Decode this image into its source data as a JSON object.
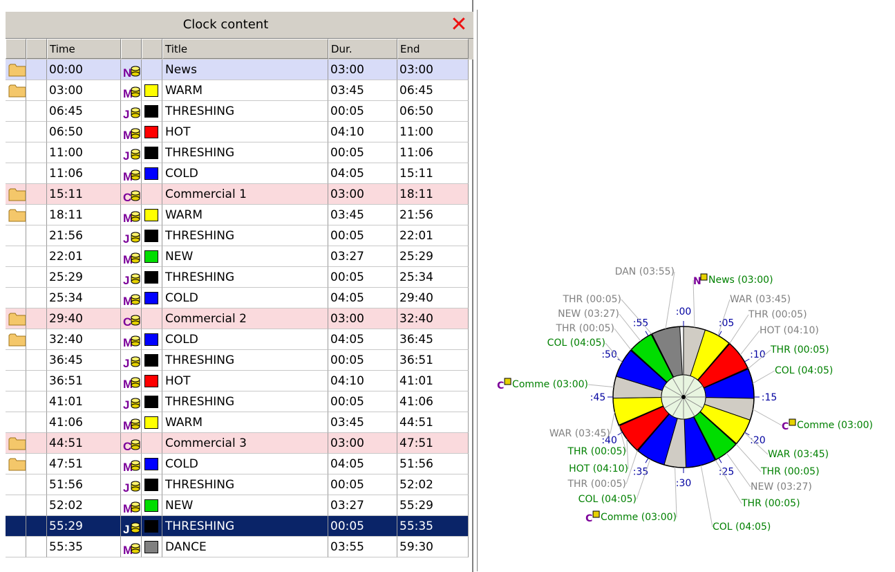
{
  "panel": {
    "title": "Clock content",
    "close_icon": "close-icon"
  },
  "columns": [
    "Time",
    "Title",
    "Dur.",
    "End"
  ],
  "rows": [
    {
      "folder": true,
      "time": "00:00",
      "type": "N",
      "color": "",
      "title": "News",
      "dur": "03:00",
      "end": "03:00",
      "style": "blue"
    },
    {
      "folder": true,
      "time": "03:00",
      "type": "M",
      "color": "#ffff00",
      "title": "WARM",
      "dur": "03:45",
      "end": "06:45",
      "style": ""
    },
    {
      "folder": false,
      "time": "06:45",
      "type": "J",
      "color": "#000000",
      "title": "THRESHING",
      "dur": "00:05",
      "end": "06:50",
      "style": ""
    },
    {
      "folder": false,
      "time": "06:50",
      "type": "M",
      "color": "#ff0000",
      "title": "HOT",
      "dur": "04:10",
      "end": "11:00",
      "style": ""
    },
    {
      "folder": false,
      "time": "11:00",
      "type": "J",
      "color": "#000000",
      "title": "THRESHING",
      "dur": "00:05",
      "end": "11:06",
      "style": ""
    },
    {
      "folder": false,
      "time": "11:06",
      "type": "M",
      "color": "#0000ff",
      "title": "COLD",
      "dur": "04:05",
      "end": "15:11",
      "style": ""
    },
    {
      "folder": true,
      "time": "15:11",
      "type": "C",
      "color": "",
      "title": "Commercial 1",
      "dur": "03:00",
      "end": "18:11",
      "style": "pink"
    },
    {
      "folder": true,
      "time": "18:11",
      "type": "M",
      "color": "#ffff00",
      "title": "WARM",
      "dur": "03:45",
      "end": "21:56",
      "style": ""
    },
    {
      "folder": false,
      "time": "21:56",
      "type": "J",
      "color": "#000000",
      "title": "THRESHING",
      "dur": "00:05",
      "end": "22:01",
      "style": ""
    },
    {
      "folder": false,
      "time": "22:01",
      "type": "M",
      "color": "#00dd00",
      "title": "NEW",
      "dur": "03:27",
      "end": "25:29",
      "style": ""
    },
    {
      "folder": false,
      "time": "25:29",
      "type": "J",
      "color": "#000000",
      "title": "THRESHING",
      "dur": "00:05",
      "end": "25:34",
      "style": ""
    },
    {
      "folder": false,
      "time": "25:34",
      "type": "M",
      "color": "#0000ff",
      "title": "COLD",
      "dur": "04:05",
      "end": "29:40",
      "style": ""
    },
    {
      "folder": true,
      "time": "29:40",
      "type": "C",
      "color": "",
      "title": "Commercial 2",
      "dur": "03:00",
      "end": "32:40",
      "style": "pink"
    },
    {
      "folder": true,
      "time": "32:40",
      "type": "M",
      "color": "#0000ff",
      "title": "COLD",
      "dur": "04:05",
      "end": "36:45",
      "style": ""
    },
    {
      "folder": false,
      "time": "36:45",
      "type": "J",
      "color": "#000000",
      "title": "THRESHING",
      "dur": "00:05",
      "end": "36:51",
      "style": ""
    },
    {
      "folder": false,
      "time": "36:51",
      "type": "M",
      "color": "#ff0000",
      "title": "HOT",
      "dur": "04:10",
      "end": "41:01",
      "style": ""
    },
    {
      "folder": false,
      "time": "41:01",
      "type": "J",
      "color": "#000000",
      "title": "THRESHING",
      "dur": "00:05",
      "end": "41:06",
      "style": ""
    },
    {
      "folder": false,
      "time": "41:06",
      "type": "M",
      "color": "#ffff00",
      "title": "WARM",
      "dur": "03:45",
      "end": "44:51",
      "style": ""
    },
    {
      "folder": true,
      "time": "44:51",
      "type": "C",
      "color": "",
      "title": "Commercial 3",
      "dur": "03:00",
      "end": "47:51",
      "style": "pink"
    },
    {
      "folder": true,
      "time": "47:51",
      "type": "M",
      "color": "#0000ff",
      "title": "COLD",
      "dur": "04:05",
      "end": "51:56",
      "style": ""
    },
    {
      "folder": false,
      "time": "51:56",
      "type": "J",
      "color": "#000000",
      "title": "THRESHING",
      "dur": "00:05",
      "end": "52:02",
      "style": ""
    },
    {
      "folder": false,
      "time": "52:02",
      "type": "M",
      "color": "#00dd00",
      "title": "NEW",
      "dur": "03:27",
      "end": "55:29",
      "style": ""
    },
    {
      "folder": false,
      "time": "55:29",
      "type": "J",
      "color": "#000000",
      "title": "THRESHING",
      "dur": "00:05",
      "end": "55:35",
      "style": "sel"
    },
    {
      "folder": false,
      "time": "55:35",
      "type": "M",
      "color": "#808080",
      "title": "DANCE",
      "dur": "03:55",
      "end": "59:30",
      "style": ""
    }
  ],
  "clock": {
    "minute_labels": [
      ":00",
      ":05",
      ":10",
      ":15",
      ":20",
      ":25",
      ":30",
      ":35",
      ":40",
      ":45",
      ":50",
      ":55"
    ],
    "segment_labels": [
      {
        "text": "News (03:00)",
        "type": "N",
        "color": "#008000"
      },
      {
        "text": "WAR (03:45)",
        "color": "#808080"
      },
      {
        "text": "THR (00:05)",
        "color": "#808080"
      },
      {
        "text": "HOT (04:10)",
        "color": "#808080"
      },
      {
        "text": "THR (00:05)",
        "color": "#008000"
      },
      {
        "text": "COL (04:05)",
        "color": "#008000"
      },
      {
        "text": "Comme (03:00)",
        "type": "C",
        "color": "#008000"
      },
      {
        "text": "WAR (03:45)",
        "color": "#008000"
      },
      {
        "text": "THR (00:05)",
        "color": "#008000"
      },
      {
        "text": "NEW (03:27)",
        "color": "#808080"
      },
      {
        "text": "THR (00:05)",
        "color": "#008000"
      },
      {
        "text": "COL (04:05)",
        "color": "#008000"
      },
      {
        "text": "Comme (03:00)",
        "type": "C",
        "color": "#008000"
      },
      {
        "text": "COL (04:05)",
        "color": "#008000"
      },
      {
        "text": "THR (00:05)",
        "color": "#808080"
      },
      {
        "text": "HOT (04:10)",
        "color": "#008000"
      },
      {
        "text": "THR (00:05)",
        "color": "#008000"
      },
      {
        "text": "WAR (03:45)",
        "color": "#808080"
      },
      {
        "text": "Comme (03:00)",
        "type": "C",
        "color": "#008000"
      },
      {
        "text": "COL (04:05)",
        "color": "#008000"
      },
      {
        "text": "THR (00:05)",
        "color": "#808080"
      },
      {
        "text": "NEW (03:27)",
        "color": "#808080"
      },
      {
        "text": "THR (00:05)",
        "color": "#808080"
      },
      {
        "text": "DAN (03:55)",
        "color": "#808080"
      }
    ]
  }
}
